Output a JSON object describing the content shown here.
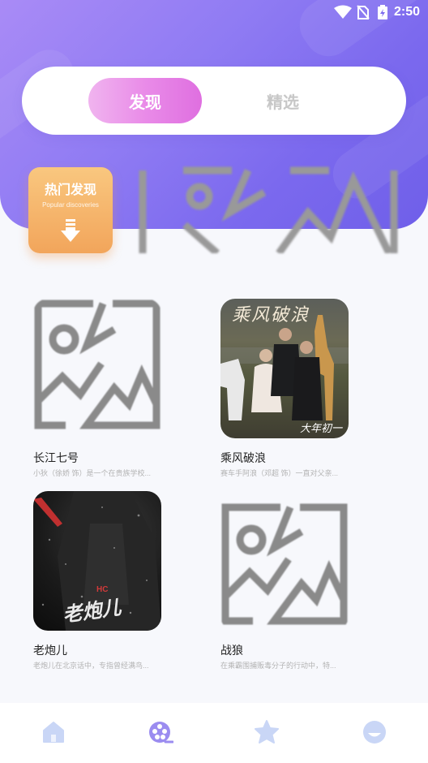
{
  "status_bar": {
    "time": "2:50",
    "icons": [
      "wifi-icon",
      "no-sim-icon",
      "battery-icon"
    ]
  },
  "tabs": [
    {
      "label": "发现",
      "active": true
    },
    {
      "label": "精选",
      "active": false
    }
  ],
  "hot_card": {
    "title": "热门发现",
    "subtitle": "Popular discoveries",
    "icon": "download-arrow-icon"
  },
  "banner": {
    "icon": "image-placeholder-icon"
  },
  "items": [
    {
      "title": "长江七号",
      "desc": "小狄（徐娇 饰）是一个在贵族学校...",
      "poster": "image-placeholder-icon"
    },
    {
      "title": "乘风破浪",
      "desc": "赛车手阿浪（邓超 饰）一直对父亲...",
      "poster": "movie-poster",
      "poster_text": "乘风破浪",
      "poster_tag": "大年初一"
    },
    {
      "title": "老炮儿",
      "desc": "老炮儿在北京话中，专指曾经满鸟...",
      "poster": "movie-poster",
      "poster_text": "老炮儿",
      "poster_tag": "HC"
    },
    {
      "title": "战狼",
      "desc": "在乘霸围捕贩毒分子的行动中，特...",
      "poster": "image-placeholder-icon"
    }
  ],
  "bottom_nav": [
    {
      "icon": "home-icon",
      "active": false
    },
    {
      "icon": "film-reel-icon",
      "active": true
    },
    {
      "icon": "star-icon",
      "active": false
    },
    {
      "icon": "smiley-icon",
      "active": false
    }
  ],
  "colors": {
    "accent_purple": "#7b69ee",
    "tab_pink": "#e98be8",
    "hot_orange": "#f2a55b",
    "nav_inactive": "#c9d6f6",
    "nav_active": "#9b8cf0"
  }
}
